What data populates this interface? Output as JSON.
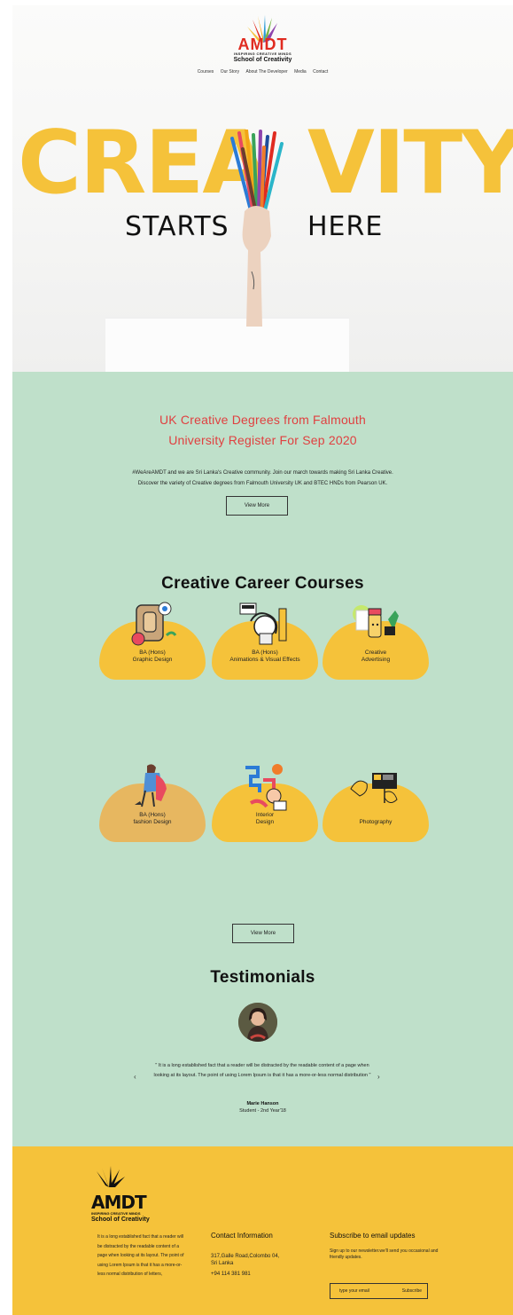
{
  "brand": {
    "name": "AMDT",
    "tagline": "INSPIRING CREATIVE MINDS",
    "school": "School of Creativity",
    "colors": {
      "yellow": "#f5c23a",
      "red": "#e02b20",
      "green_bg": "#bfe0ca"
    }
  },
  "nav": {
    "items": [
      "Courses",
      "Our Story",
      "About The Developer",
      "Media",
      "Contact"
    ]
  },
  "hero": {
    "word_left": "CREA",
    "word_right": "VITY",
    "sub_left": "STARTS",
    "sub_right": "HERE"
  },
  "intro": {
    "headline_1": "UK Creative Degrees from Falmouth",
    "headline_2": "University Register For Sep 2020",
    "body": "#WeAreAMDT and we are Sri Lanka's Creative community. Join our march towards making Sri Lanka Creative. Discover the variety of Creative degrees from Falmouth University UK and BTEC HNDs from Pearson UK.",
    "button": "View More"
  },
  "courses": {
    "title": "Creative Career Courses",
    "items": [
      {
        "line1": "BA (Hons)",
        "line2": "Graphic Design",
        "icon": "graphic-design-illustration"
      },
      {
        "line1": "BA (Hons)",
        "line2": "Animations & Visual Effects",
        "icon": "animation-illustration"
      },
      {
        "line1": "Creative",
        "line2": "Advertising",
        "icon": "advertising-illustration"
      },
      {
        "line1": "BA (Hons)",
        "line2": "fashion Design",
        "icon": "fashion-illustration"
      },
      {
        "line1": "Interior",
        "line2": "Design",
        "icon": "interior-illustration"
      },
      {
        "line1": "Photography",
        "line2": "",
        "icon": "photography-illustration"
      }
    ],
    "button": "View More"
  },
  "testimonials": {
    "title": "Testimonials",
    "quote": "\" It is a long established fact that a reader will be distracted by the readable content of a page when looking at its layout. The point of using Lorem Ipsum is that it has a more-or-less normal distribution \"",
    "name": "Marie Hanson",
    "role": "Student - 2nd Year'18",
    "prev": "‹",
    "next": "›"
  },
  "footer": {
    "about": "It is a long established fact that a reader will be distracted by the readable content of a page when looking at its layout. The point of using Lorem Ipsum is that it has a more-or-less normal distribution of letters,",
    "contact_title": "Contact Information",
    "address_1": "317,Galle Road,Colombo 04,",
    "address_2": "Sri Lanka",
    "phone": "+94 114 381 981",
    "subscribe_title": "Subscribe to email updates",
    "subscribe_text": "Sign up to our newsletter.we'll send you occasional and friendly updates.",
    "email_placeholder": "type your email",
    "subscribe_button": "Subscribe"
  }
}
